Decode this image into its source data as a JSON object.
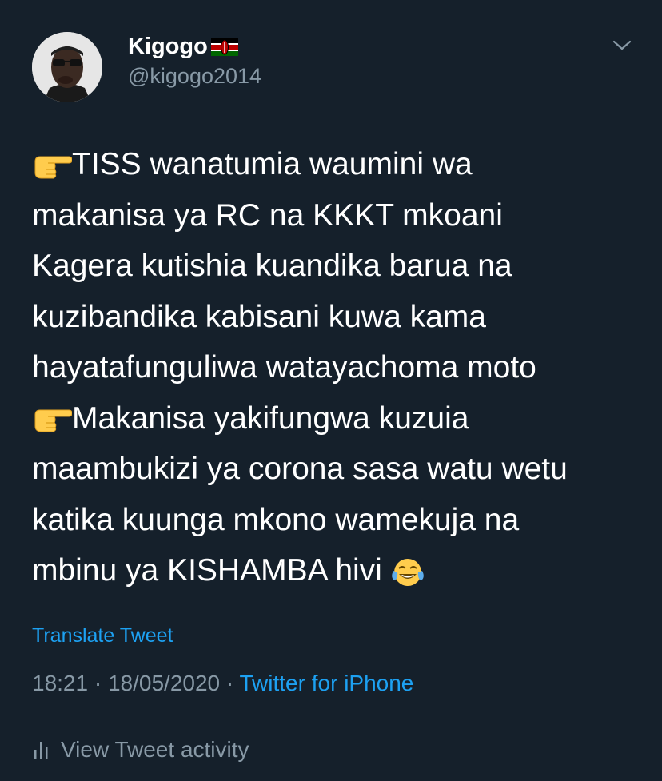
{
  "user": {
    "display_name": "Kigogo",
    "flag_icon": "kenya-flag-icon",
    "handle": "@kigogo2014"
  },
  "menu": {
    "icon": "chevron-down-icon"
  },
  "tweet": {
    "lines": [
      {
        "emoji": "backhand-index-pointing-right-emoji",
        "text": "TISS  wanatumia waumini wa"
      },
      {
        "text": "makanisa ya RC na KKKT mkoani"
      },
      {
        "text": "Kagera kutishia kuandika barua na"
      },
      {
        "text": "kuzibandika kabisani  kuwa kama"
      },
      {
        "text": "hayatafunguliwa watayachoma moto"
      },
      {
        "emoji": "backhand-index-pointing-right-emoji",
        "text": "Makanisa yakifungwa kuzuia"
      },
      {
        "text": "maambukizi ya corona sasa watu wetu"
      },
      {
        "text": "katika kuunga mkono wamekuja na"
      },
      {
        "text": "mbinu ya KISHAMBA hivi ",
        "trailing_emoji": "face-with-tears-of-joy-emoji"
      }
    ]
  },
  "translate_label": "Translate Tweet",
  "meta": {
    "time": "18:21",
    "separator": " · ",
    "date": "18/05/2020",
    "source": "Twitter for iPhone"
  },
  "activity": {
    "icon": "bar-chart-icon",
    "label": "View Tweet activity"
  },
  "colors": {
    "background": "#15202b",
    "text": "#ffffff",
    "secondary": "#8899a6",
    "link": "#1da1f2",
    "divider": "#38444d"
  }
}
